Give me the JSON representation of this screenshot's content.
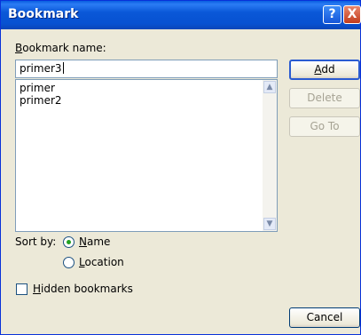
{
  "window": {
    "title": "Bookmark",
    "help_glyph": "?",
    "close_glyph": "X"
  },
  "bookmark_name": {
    "label_u": "B",
    "label_rest": "ookmark name:",
    "value": "primer3"
  },
  "bookmark_list": {
    "items": [
      "primer",
      "primer2"
    ]
  },
  "buttons": {
    "add_u": "A",
    "add_rest": "dd",
    "delete": "Delete",
    "goto": "Go To",
    "cancel": "Cancel"
  },
  "sort": {
    "label": "Sort by:",
    "name_u": "N",
    "name_rest": "ame",
    "location_u": "L",
    "location_rest": "ocation",
    "selected": "Name"
  },
  "hidden": {
    "label_u": "H",
    "label_rest": "idden bookmarks",
    "checked": false
  }
}
